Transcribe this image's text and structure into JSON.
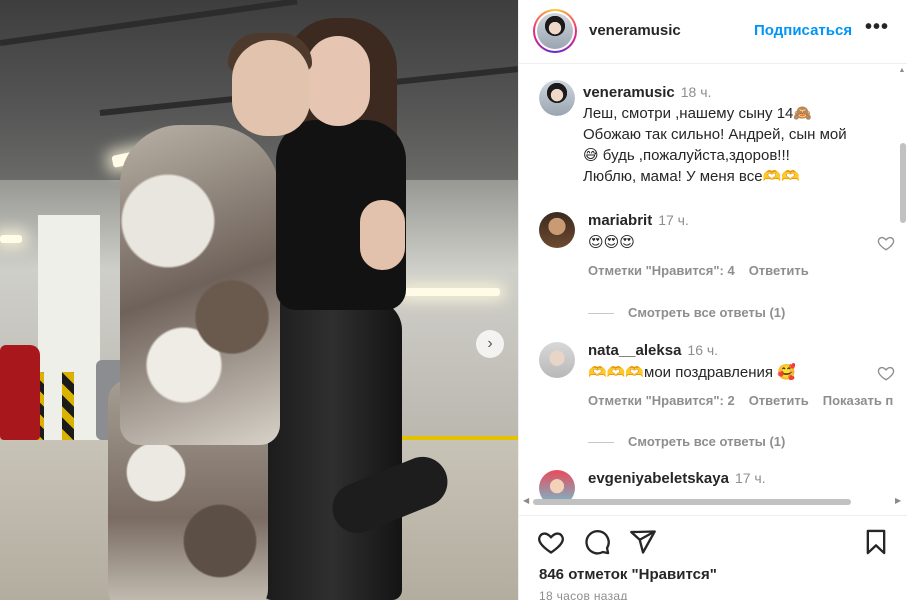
{
  "post": {
    "username": "veneramusic",
    "follow_label": "Подписаться",
    "more_label": "•••",
    "next_label": "›"
  },
  "caption": {
    "username": "veneramusic",
    "time": "18 ч.",
    "line1": "Леш, смотри ,нашему сыну 14🙈",
    "line2": "Обожаю так сильно! Андрей, сын мой",
    "line3": "😅 будь ,пожалуйста,здоров!!!",
    "line4": "Люблю, мама! У меня все🫶🫶"
  },
  "comments": [
    {
      "username": "mariabrit",
      "time": "17 ч.",
      "text": "😍😍😍",
      "likes_label": "Отметки \"Нравится\": 4",
      "reply_label": "Ответить",
      "view_replies": "Смотреть все ответы (1)"
    },
    {
      "username": "nata__aleksa",
      "time": "16 ч.",
      "text": "🫶🫶🫶мои поздравления 🥰",
      "likes_label": "Отметки \"Нравится\": 2",
      "reply_label": "Ответить",
      "translate_label": "Показать п",
      "view_replies": "Смотреть все ответы (1)"
    },
    {
      "username": "evgeniyabeletskaya",
      "time": "17 ч."
    }
  ],
  "footer": {
    "likes": "846 отметок \"Нравится\"",
    "posted": "18 часов назад"
  }
}
